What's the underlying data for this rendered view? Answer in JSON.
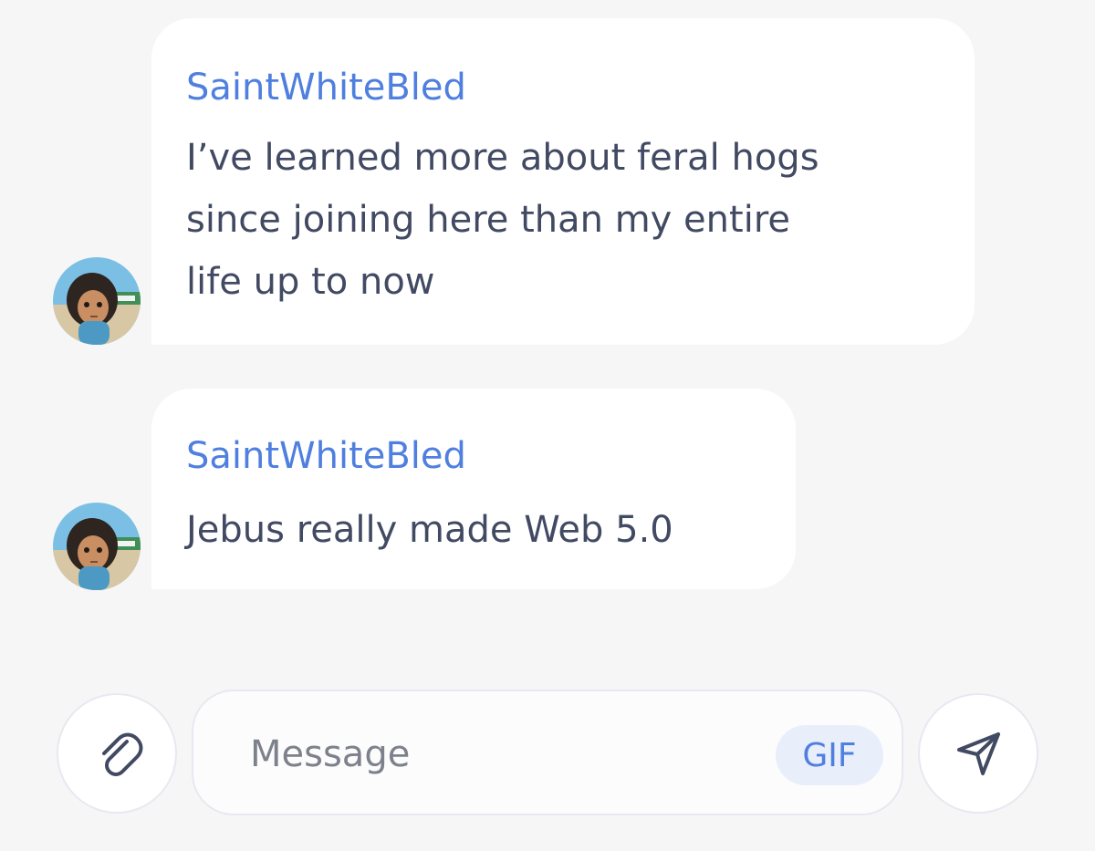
{
  "messages": [
    {
      "sender": "SaintWhiteBled",
      "text": "I’ve learned more about feral hogs\nsince joining here than my entire\nlife up to now"
    },
    {
      "sender": "SaintWhiteBled",
      "text": "Jebus really made Web 5.0"
    }
  ],
  "composer": {
    "placeholder": "Message",
    "gif_label": "GIF",
    "attach_icon": "paperclip-icon",
    "send_icon": "send-icon"
  },
  "colors": {
    "background": "#f6f6f7",
    "bubble": "#ffffff",
    "sender": "#4f7fdf",
    "text": "#424a63",
    "placeholder": "#7d818c",
    "gif_bg": "#e9eefb"
  }
}
